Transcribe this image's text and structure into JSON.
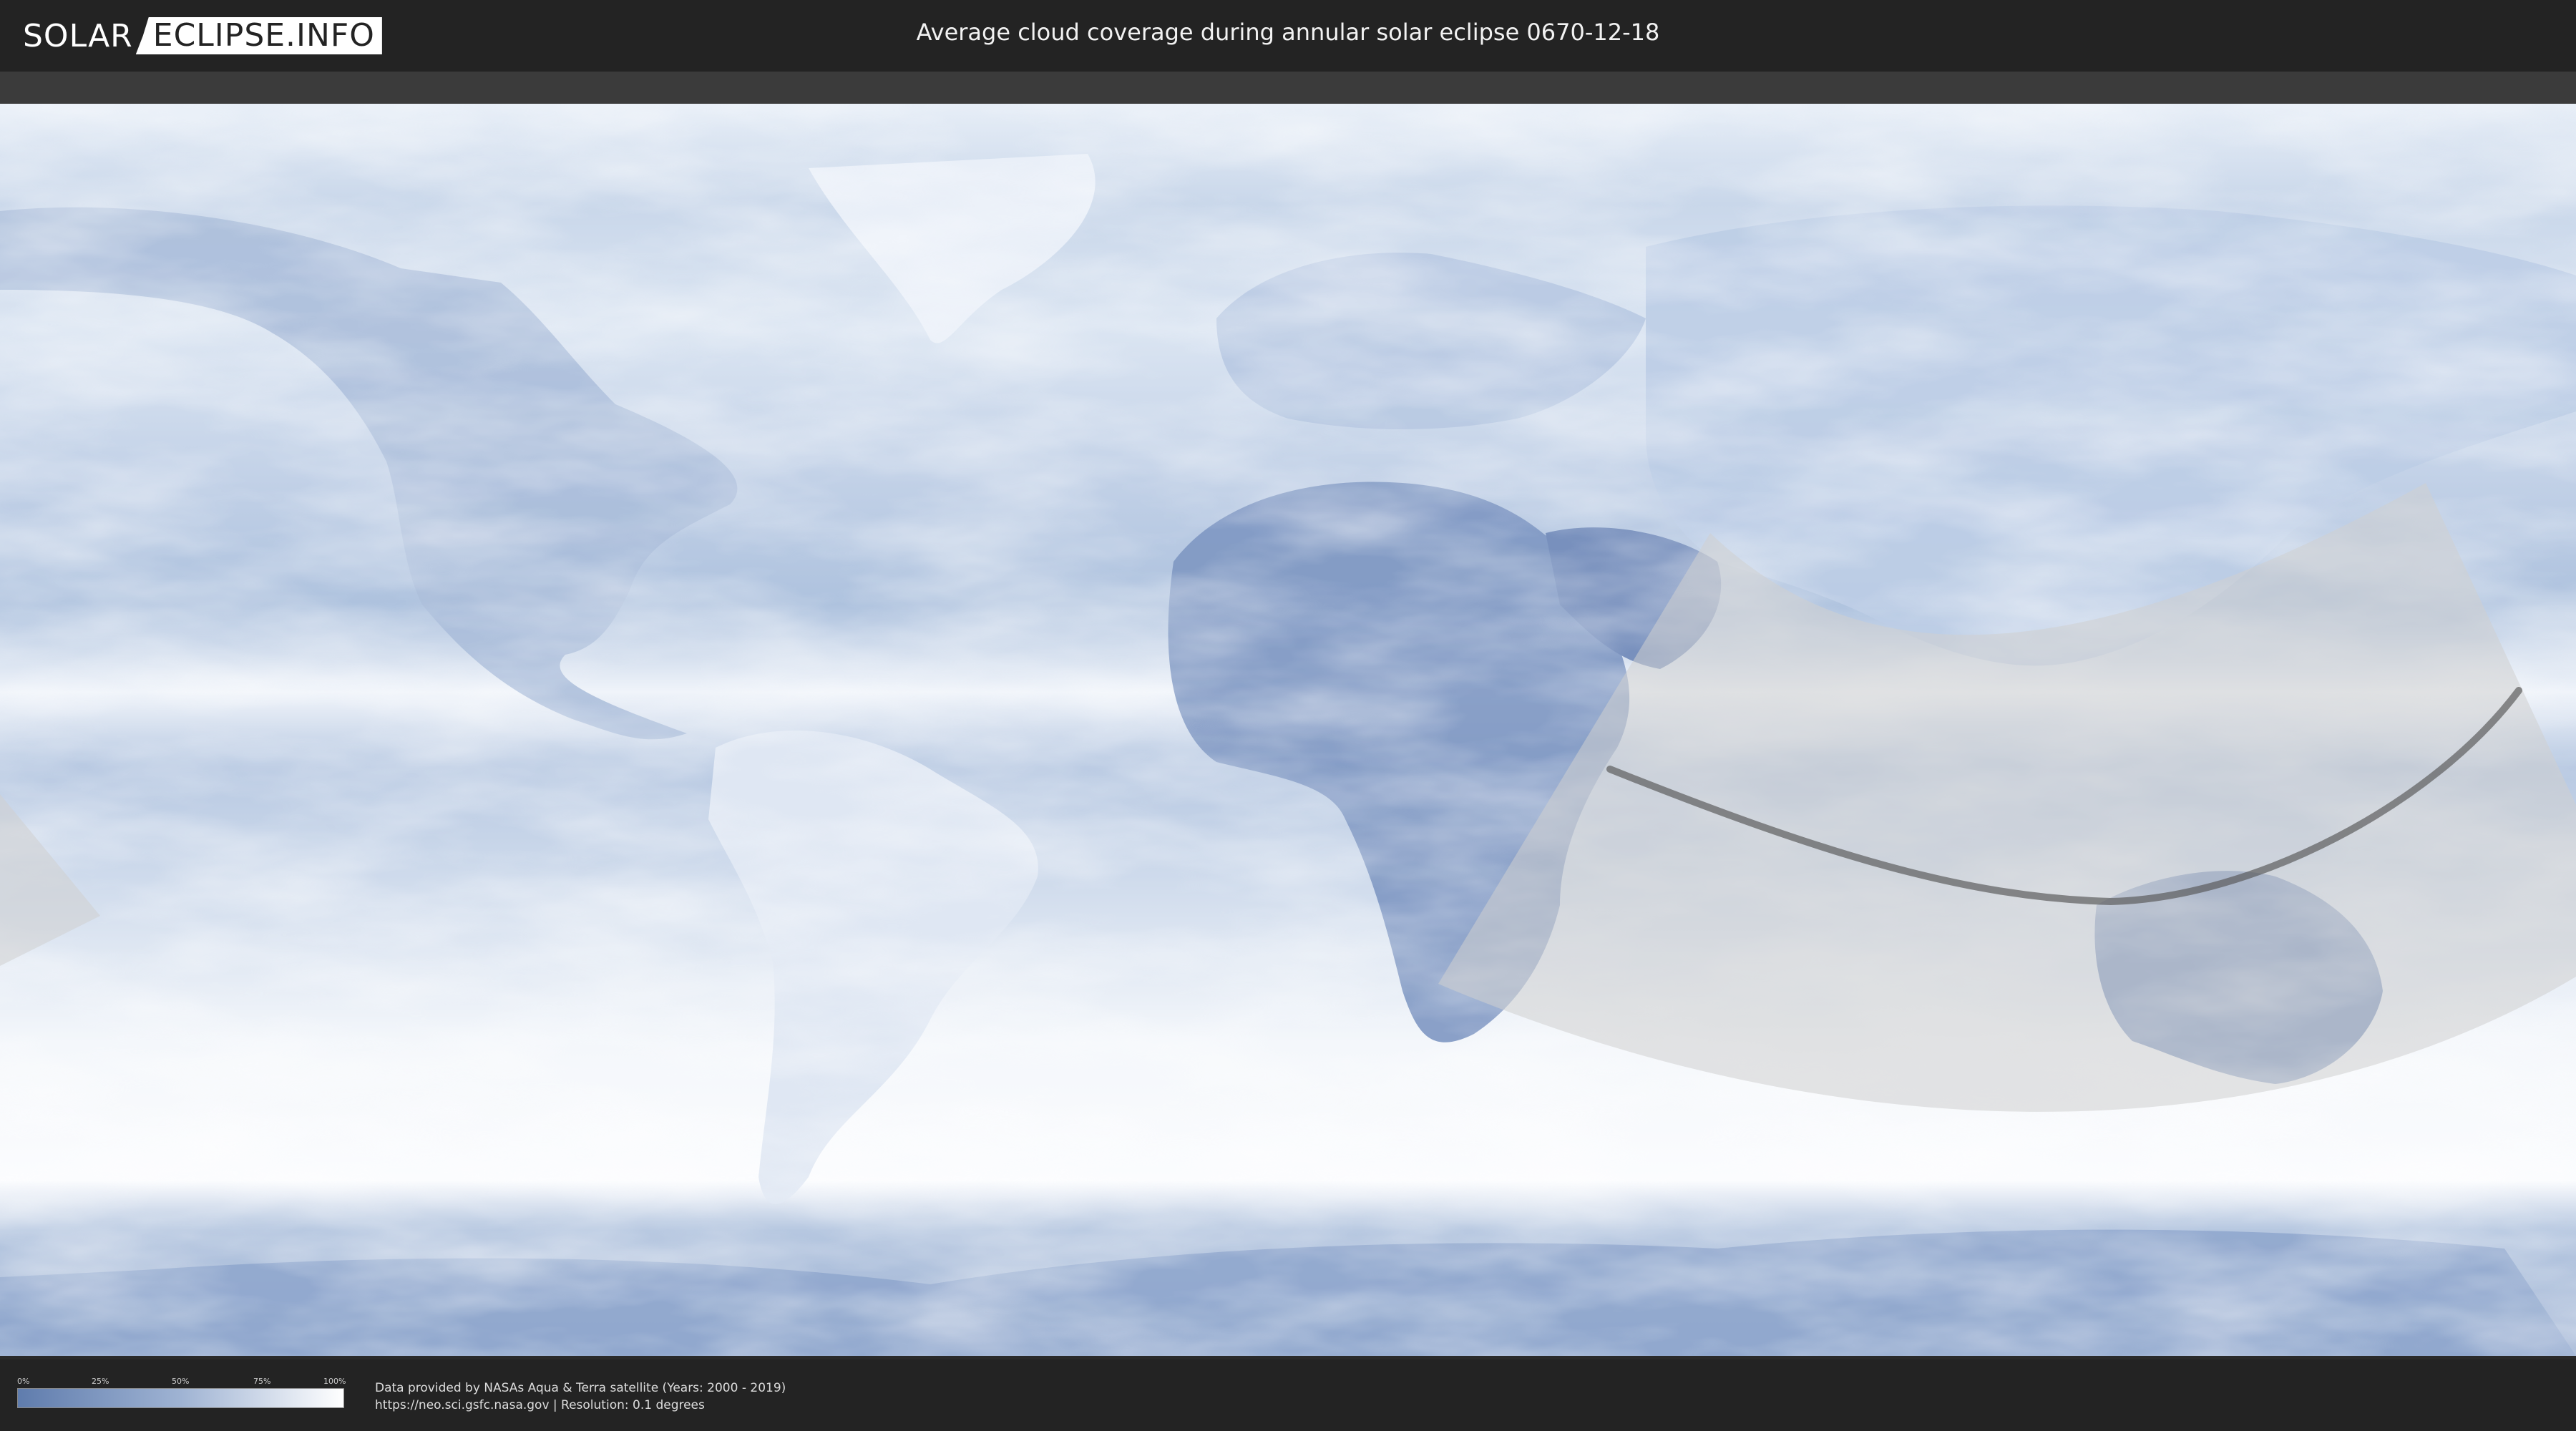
{
  "header": {
    "logo_left": "SOLAR",
    "logo_right": "ECLIPSE.INFO",
    "title": "Average cloud coverage during annular solar eclipse 0670-12-18"
  },
  "legend": {
    "ticks": [
      "0%",
      "25%",
      "50%",
      "75%",
      "100%"
    ],
    "gradient_colors": [
      "#5f7cad",
      "#ffffff"
    ]
  },
  "footer": {
    "credit_line1": "Data provided by NASAs Aqua & Terra satellite (Years: 2000 - 2019)",
    "credit_line2": "https://neo.sci.gsfc.nasa.gov | Resolution: 0.1 degrees"
  },
  "colors": {
    "header_bg": "#232323",
    "cloud_clear": "#6c88b8",
    "cloud_full": "#f4f7fb",
    "eclipse_zone": "#cfcfcf",
    "central_path": "#555555"
  }
}
